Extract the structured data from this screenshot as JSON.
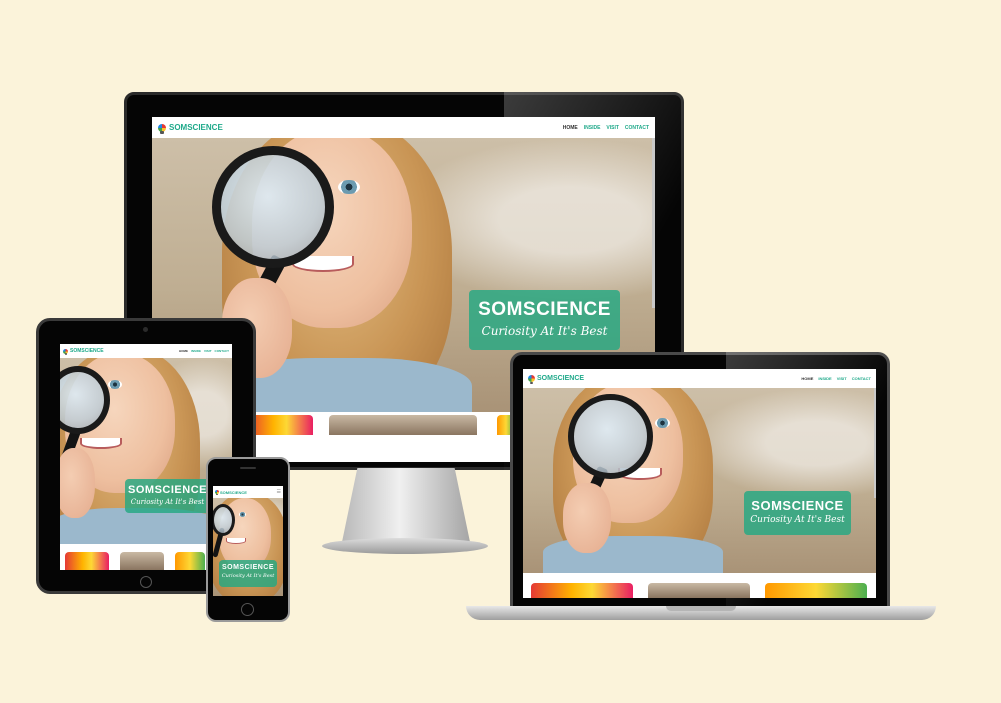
{
  "site": {
    "brand": "SOMSCIENCE",
    "nav": [
      {
        "label": "HOME",
        "active": true
      },
      {
        "label": "INSIDE",
        "active": false
      },
      {
        "label": "VISIT",
        "active": false
      },
      {
        "label": "CONTACT",
        "active": false
      }
    ],
    "hero": {
      "title": "SOMSCIENCE",
      "tagline": "Curiosity At It's Best"
    }
  },
  "icons": {
    "logo": "lightbulb-logo-icon",
    "mobile_menu": "hamburger-menu-icon"
  },
  "colors": {
    "background": "#fbf3da",
    "brand": "#1fa98a",
    "badge": "#25a882"
  }
}
